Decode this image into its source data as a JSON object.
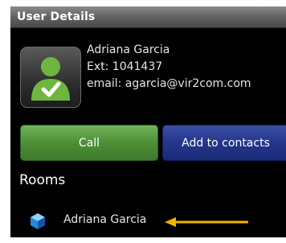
{
  "header": {
    "title": "User Details"
  },
  "user": {
    "name": "Adriana Garcia",
    "extension": "Ext: 1041437",
    "email": "email: agarcia@vir2com.com",
    "avatar_icon": "user-check-icon"
  },
  "actions": {
    "call_label": "Call",
    "add_contacts_label": "Add to contacts"
  },
  "rooms": {
    "heading": "Rooms",
    "items": [
      {
        "label": "Adriana Garcia",
        "icon": "room-cube-icon"
      }
    ]
  },
  "annotation": {
    "icon": "left-arrow-icon",
    "color": "#f0b400"
  },
  "colors": {
    "call_button": "#4d8f36",
    "add_button": "#25368a",
    "background": "#000000"
  }
}
